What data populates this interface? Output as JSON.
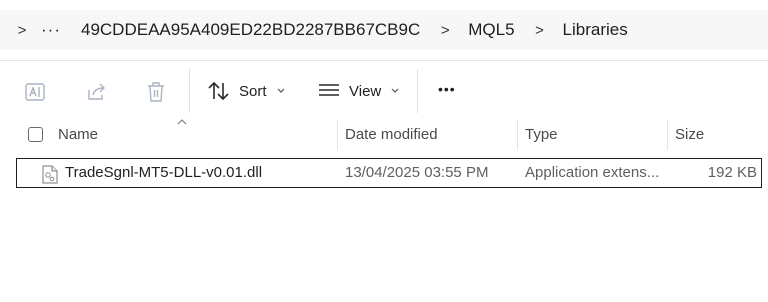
{
  "breadcrumb": {
    "expand_chevron": ">",
    "ellipsis": "···",
    "items": [
      {
        "label": "49CDDEAA95A409ED22BD2287BB67CB9C",
        "sep": ">"
      },
      {
        "label": "MQL5",
        "sep": ">"
      },
      {
        "label": "Libraries"
      }
    ]
  },
  "toolbar": {
    "sort_label": "Sort",
    "view_label": "View",
    "more": "•••"
  },
  "columns": {
    "name": "Name",
    "date": "Date modified",
    "type": "Type",
    "size": "Size"
  },
  "files": [
    {
      "name": "TradeSgnl-MT5-DLL-v0.01.dll",
      "date": "13/04/2025 03:55 PM",
      "type": "Application extens...",
      "size": "192 KB",
      "icon": "dll-file-icon"
    }
  ],
  "colors": {
    "address_bg": "#f7f7f7",
    "disabled_icon": "#b0b8c4",
    "divider": "#e0e0e0"
  }
}
